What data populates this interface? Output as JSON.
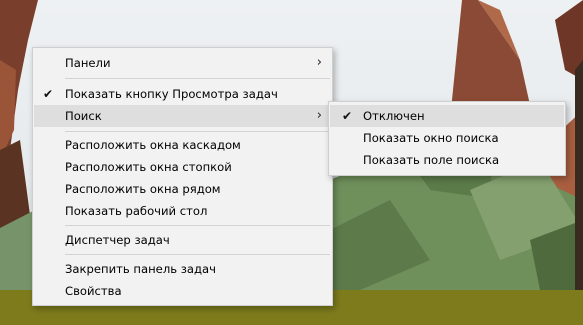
{
  "context_menu": {
    "items": [
      {
        "label": "Панели",
        "has_submenu": true
      },
      {
        "label": "Показать кнопку Просмотра задач",
        "checked": true
      },
      {
        "label": "Поиск",
        "has_submenu": true,
        "highlighted": true
      },
      {
        "label": "Расположить окна каскадом"
      },
      {
        "label": "Расположить окна стопкой"
      },
      {
        "label": "Расположить окна рядом"
      },
      {
        "label": "Показать рабочий стол"
      },
      {
        "label": "Диспетчер задач"
      },
      {
        "label": "Закрепить панель задач"
      },
      {
        "label": "Свойства"
      }
    ]
  },
  "search_submenu": {
    "items": [
      {
        "label": "Отключен",
        "checked": true,
        "highlighted": true
      },
      {
        "label": "Показать окно поиска"
      },
      {
        "label": "Показать поле поиска"
      }
    ]
  },
  "icons": {
    "check": "✔",
    "chevron": "›"
  },
  "colors": {
    "menu_bg": "#f2f2f2",
    "highlight": "#dedede",
    "taskbar_olive": "#7d7b1c"
  }
}
